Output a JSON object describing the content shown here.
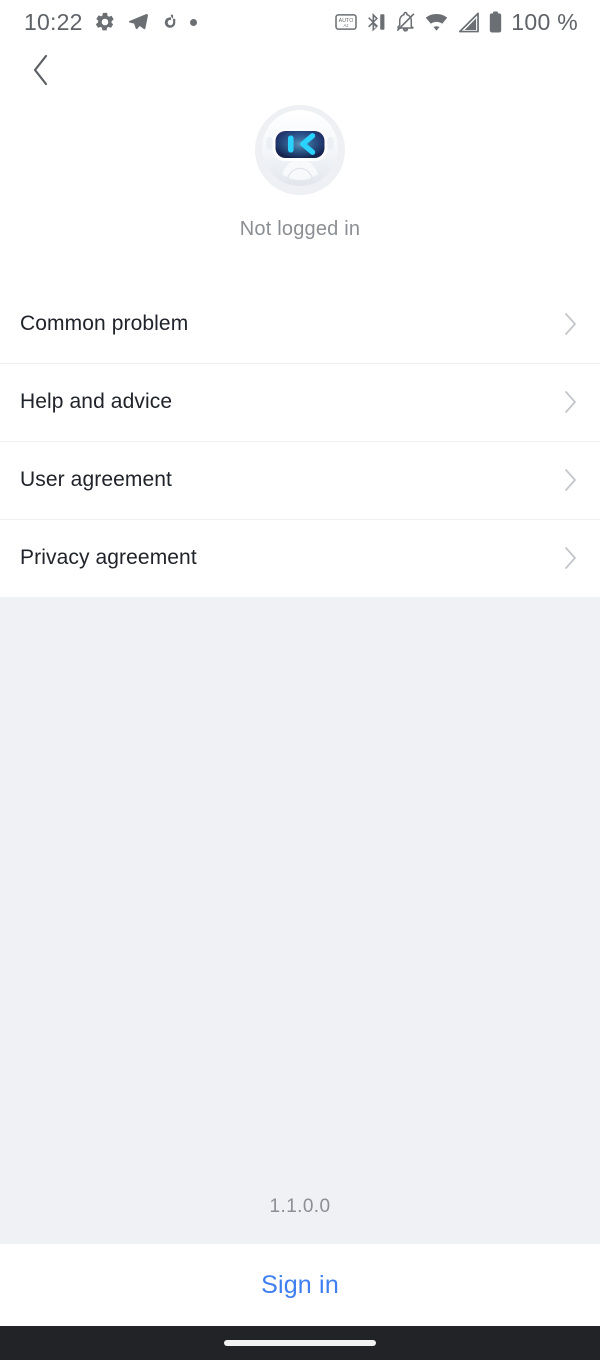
{
  "status_bar": {
    "time": "10:22",
    "battery_text": "100 %",
    "left_icons": [
      "gear-icon",
      "telegram-send-icon",
      "tiktok-note-icon",
      "dot-icon"
    ],
    "right_icons": [
      "auto-rotate-icon",
      "bluetooth-battery-icon",
      "notifications-muted-icon",
      "wifi-icon",
      "cellular-signal-icon",
      "battery-icon"
    ]
  },
  "navigation": {
    "back_icon": "chevron-left-icon"
  },
  "profile": {
    "avatar_icon": "robot-avatar-icon",
    "login_status": "Not logged in",
    "visor_glyph": "|<",
    "colors": {
      "visor_background": "#1b2a5e",
      "visor_glyph": "#26c8ff",
      "head": "#f2f4f7"
    }
  },
  "menu": {
    "items": [
      {
        "label": "Common problem",
        "chevron": "chevron-right-icon"
      },
      {
        "label": "Help and advice",
        "chevron": "chevron-right-icon"
      },
      {
        "label": "User agreement",
        "chevron": "chevron-right-icon"
      },
      {
        "label": "Privacy agreement",
        "chevron": "chevron-right-icon"
      }
    ]
  },
  "footer": {
    "version": "1.1.0.0",
    "sign_in_label": "Sign in",
    "sign_in_color": "#3f7ff0"
  },
  "system_nav": {
    "home_indicator": "home-indicator-pill"
  },
  "theme": {
    "page_background": "#ffffff",
    "panel_background": "#f0f1f4",
    "divider": "#eeeff1",
    "primary_text": "#20232a",
    "secondary_text": "#8b8e93",
    "nav_bar": "#222326"
  }
}
